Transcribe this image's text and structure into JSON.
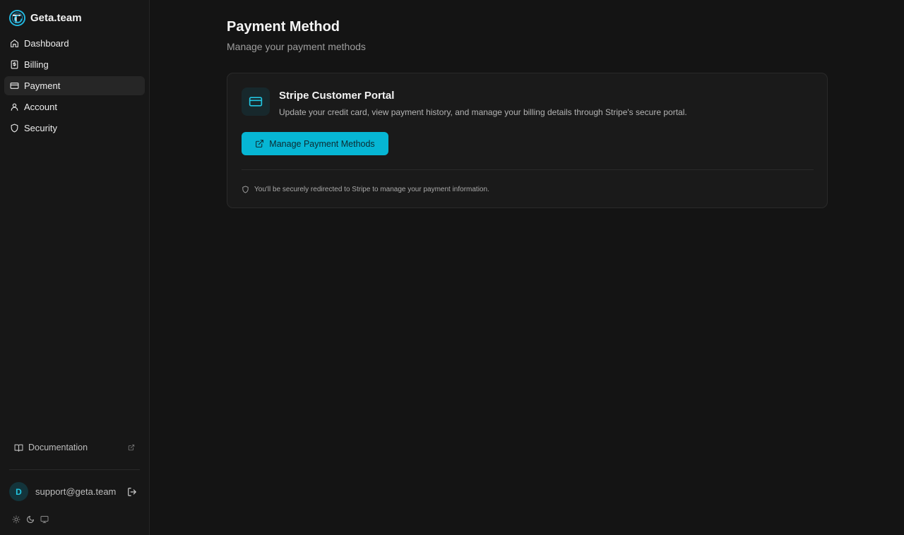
{
  "app": {
    "brand_name": "Geta.team"
  },
  "sidebar": {
    "items": [
      {
        "label": "Dashboard",
        "icon": "home-icon",
        "active": false
      },
      {
        "label": "Billing",
        "icon": "receipt-icon",
        "active": false
      },
      {
        "label": "Payment",
        "icon": "credit-card-icon",
        "active": true
      },
      {
        "label": "Account",
        "icon": "user-icon",
        "active": false
      },
      {
        "label": "Security",
        "icon": "shield-icon",
        "active": false
      }
    ],
    "documentation_label": "Documentation",
    "user": {
      "avatar_initial": "D",
      "email": "support@geta.team"
    },
    "theme_options": [
      "sun-icon",
      "moon-icon",
      "monitor-icon"
    ]
  },
  "page": {
    "title": "Payment Method",
    "subtitle": "Manage your payment methods"
  },
  "card": {
    "title": "Stripe Customer Portal",
    "description": "Update your credit card, view payment history, and manage your billing details through Stripe's secure portal.",
    "button_label": "Manage Payment Methods",
    "notice": "You'll be securely redirected to Stripe to manage your payment information."
  },
  "colors": {
    "accent": "#06b6d4",
    "background": "#141414",
    "sidebar_background": "#171717",
    "card_background": "#1a1a1a"
  }
}
